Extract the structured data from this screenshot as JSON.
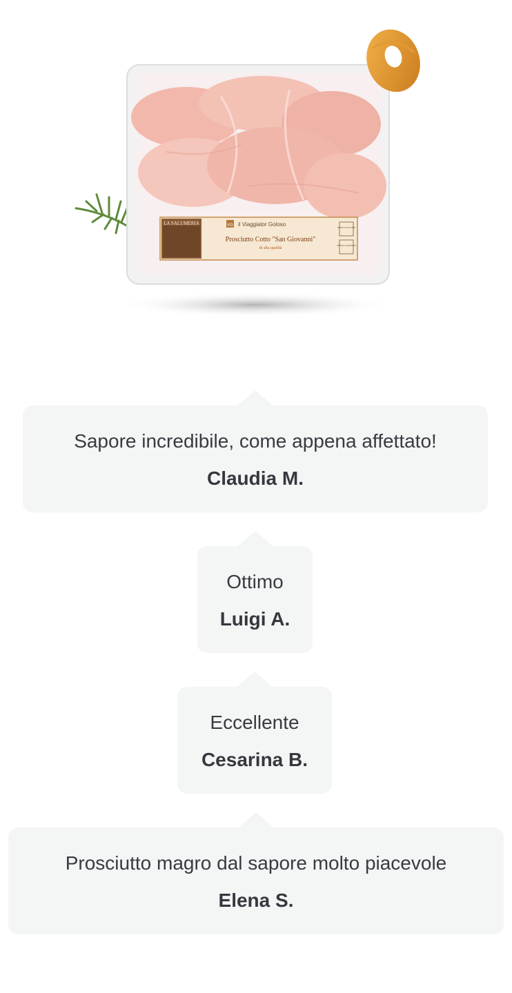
{
  "product": {
    "image_name": "prosciutto-package-image",
    "label": {
      "store_tag": "LA SALUMERIA",
      "brand": "il Viaggiator Goloso",
      "brand_logo": "VG",
      "product_name": "Prosciutto Cotto \"San Giovanni\"",
      "quality": "di alta qualità",
      "badge_1": "SENZA GLUTINE",
      "badge_2": "SENZA LATTOSIO"
    }
  },
  "reviews": [
    {
      "text": "Sapore incredibile, come appena affettato!",
      "author": "Claudia M."
    },
    {
      "text": "Ottimo",
      "author": "Luigi A."
    },
    {
      "text": "Eccellente",
      "author": "Cesarina B."
    },
    {
      "text": "Prosciutto magro dal sapore molto piacevole",
      "author": "Elena S."
    }
  ],
  "colors": {
    "review_bg": "#f4f5f5",
    "text": "#363c41",
    "ham": "#f2b8ac",
    "label_bg": "#f6e8d2"
  }
}
